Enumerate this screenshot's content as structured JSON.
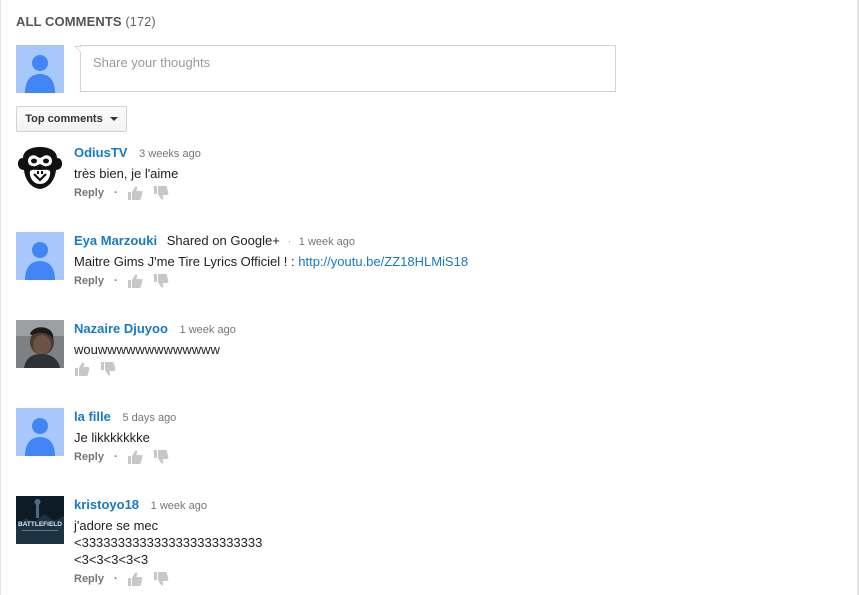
{
  "header": {
    "title": "ALL COMMENTS",
    "count": "(172)"
  },
  "share": {
    "placeholder": "Share your thoughts"
  },
  "sort": {
    "label": "Top comments"
  },
  "icons": {
    "avatar_default": "default-user-avatar-icon",
    "thumb_up": "thumb-up-icon",
    "thumb_down": "thumb-down-icon",
    "caret": "caret-down-icon"
  },
  "colors": {
    "author_link": "#167ac6",
    "avatar_bg": "#a8c7fa",
    "avatar_fg": "#4285f4"
  },
  "comments": [
    {
      "author": "OdiusTV",
      "time": "3 weeks ago",
      "text": "très bien, je l'aime",
      "reply": "Reply",
      "avatar": "monkey-logo"
    },
    {
      "author": "Eya Marzouki",
      "shared": "Shared on Google+",
      "dot": "·",
      "time": "1 week ago",
      "text": "Maitre Gims J'me Tire Lyrics Officiel ! : ",
      "link": "http://youtu.be/ZZ18HLMiS18",
      "reply": "Reply",
      "avatar": "default"
    },
    {
      "author": "Nazaire Djuyoo",
      "time": "1 week ago",
      "text": "wouwwwwwwwwwwwww",
      "avatar": "photo"
    },
    {
      "author": "la fille",
      "time": "5 days ago",
      "text": "Je likkkkkkke",
      "reply": "Reply",
      "avatar": "default"
    },
    {
      "author": "kristoyo18",
      "time": "1 week ago",
      "text_lines": [
        "j'adore se mec",
        "<3333333333333333333333333",
        "<3<3<3<3<3"
      ],
      "reply": "Reply",
      "avatar": "battlefield",
      "avatar_text": "BATTLEFIELD"
    }
  ],
  "action_separator": "·"
}
